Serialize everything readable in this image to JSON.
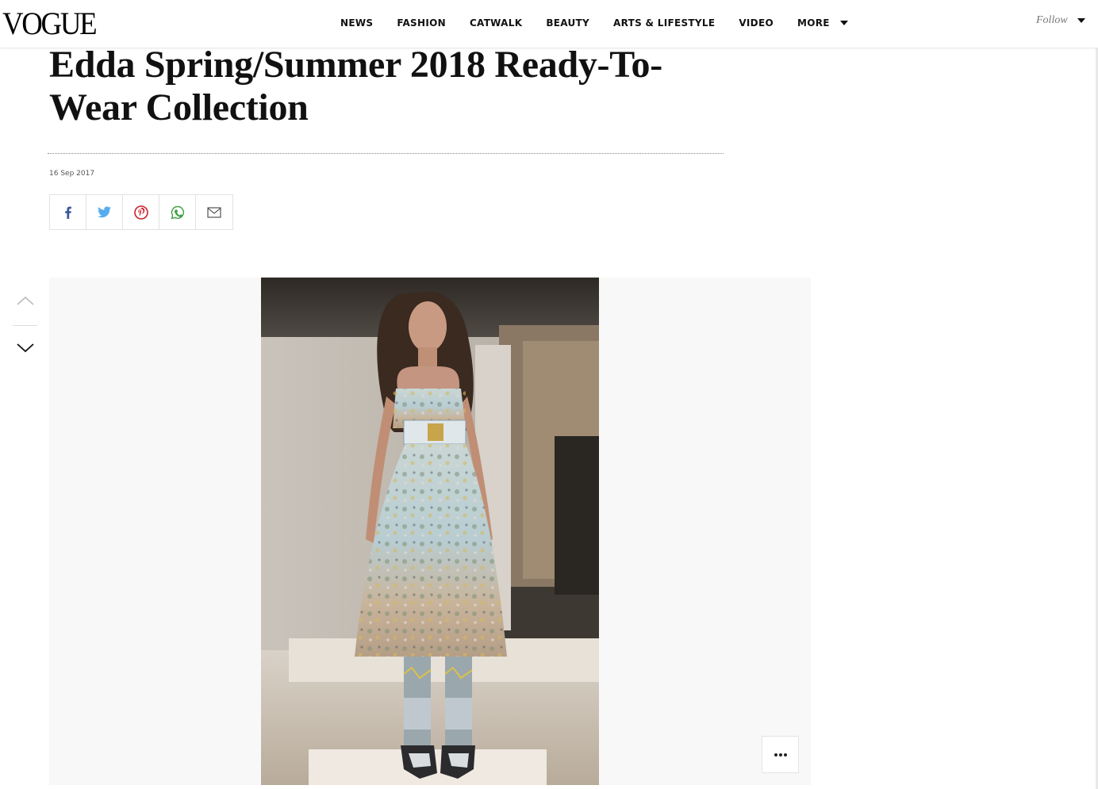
{
  "header": {
    "logo": "VOGUE",
    "nav": [
      {
        "label": "NEWS"
      },
      {
        "label": "FASHION"
      },
      {
        "label": "CATWALK"
      },
      {
        "label": "BEAUTY"
      },
      {
        "label": "ARTS & LIFESTYLE"
      },
      {
        "label": "VIDEO"
      }
    ],
    "more_label": "MORE",
    "follow_label": "Follow"
  },
  "article": {
    "title": "Edda Spring/Summer 2018 Ready-To-Wear Collection",
    "date": "16 Sep 2017"
  },
  "share": {
    "icons": [
      "facebook-icon",
      "twitter-icon",
      "pinterest-icon",
      "whatsapp-icon",
      "email-icon"
    ],
    "colors": {
      "facebook": "#3b5998",
      "twitter": "#55acee",
      "pinterest": "#cb2027",
      "whatsapp": "#43a047",
      "email": "#444444"
    }
  },
  "gallery": {
    "icons": {
      "prev": "chevron-up-icon",
      "next": "chevron-down-icon",
      "more": "ellipsis-icon"
    }
  }
}
